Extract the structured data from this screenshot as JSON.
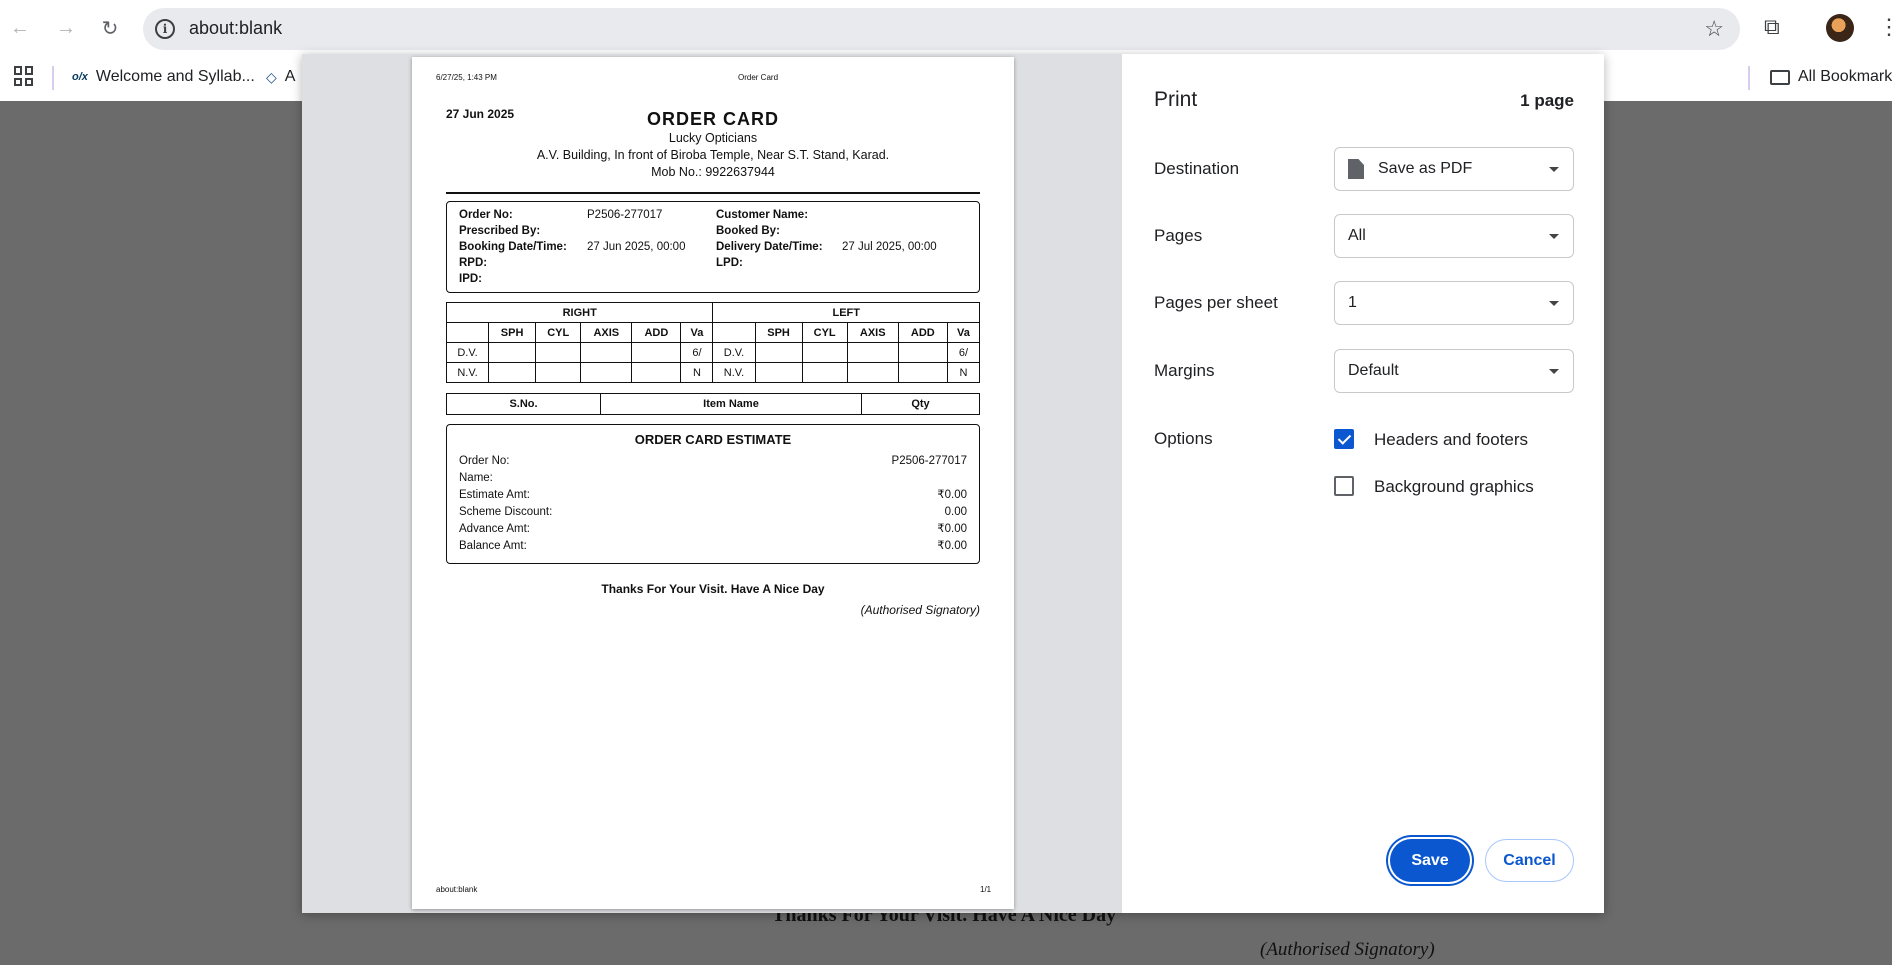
{
  "browser": {
    "url": "about:blank",
    "bookmarks": [
      {
        "label": "Welcome and Syllab..."
      },
      {
        "label": "A"
      }
    ],
    "all_bookmarks_label": "All Bookmarks"
  },
  "background": {
    "thanks": "Thanks For Your Visit. Have A Nice Day",
    "signatory": "(Authorised Signatory)"
  },
  "preview": {
    "header_datetime": "6/27/25, 1:43 PM",
    "header_title": "Order Card",
    "footer_url": "about:blank",
    "footer_page": "1/1",
    "doc": {
      "date": "27 Jun 2025",
      "title": "ORDER CARD",
      "shop_name": "Lucky Opticians",
      "address": "A.V. Building, In front of Biroba Temple, Near S.T. Stand, Karad.",
      "mobile": "Mob No.: 9922637944",
      "info": {
        "order_no_label": "Order No:",
        "order_no": "P2506-277017",
        "customer_name_label": "Customer Name:",
        "customer_name": "",
        "prescribed_by_label": "Prescribed By:",
        "booked_by_label": "Booked By:",
        "booking_dt_label": "Booking Date/Time:",
        "booking_dt": "27 Jun 2025, 00:00",
        "delivery_dt_label": "Delivery Date/Time:",
        "delivery_dt": "27 Jul 2025, 00:00",
        "rpd_label": "RPD:",
        "lpd_label": "LPD:",
        "ipd_label": "IPD:"
      },
      "rx": {
        "right_label": "RIGHT",
        "left_label": "LEFT",
        "columns": [
          "SPH",
          "CYL",
          "AXIS",
          "ADD",
          "Va"
        ],
        "rows": [
          {
            "label": "D.V.",
            "right_va": "6/",
            "left_va": "6/"
          },
          {
            "label": "N.V.",
            "right_va": "N",
            "left_va": "N"
          }
        ]
      },
      "items_columns": [
        "S.No.",
        "Item Name",
        "Qty"
      ],
      "estimate": {
        "title": "ORDER CARD ESTIMATE",
        "rows": [
          {
            "label": "Order No:",
            "value": "P2506-277017"
          },
          {
            "label": "Name:",
            "value": ""
          },
          {
            "label": "Estimate Amt:",
            "value": "₹0.00"
          },
          {
            "label": "Scheme Discount:",
            "value": "0.00"
          },
          {
            "label": "Advance Amt:",
            "value": "₹0.00"
          },
          {
            "label": "Balance Amt:",
            "value": "₹0.00"
          }
        ]
      },
      "thanks": "Thanks For Your Visit. Have A Nice Day",
      "signatory": "(Authorised Signatory)"
    }
  },
  "print": {
    "title": "Print",
    "page_count": "1 page",
    "destination_label": "Destination",
    "destination_value": "Save as PDF",
    "pages_label": "Pages",
    "pages_value": "All",
    "pps_label": "Pages per sheet",
    "pps_value": "1",
    "margins_label": "Margins",
    "margins_value": "Default",
    "options_label": "Options",
    "headers_footers_label": "Headers and footers",
    "background_graphics_label": "Background graphics",
    "save_label": "Save",
    "cancel_label": "Cancel"
  },
  "colors": {
    "accent": "#0b57d0",
    "page_gray": "#6b6b6b"
  }
}
